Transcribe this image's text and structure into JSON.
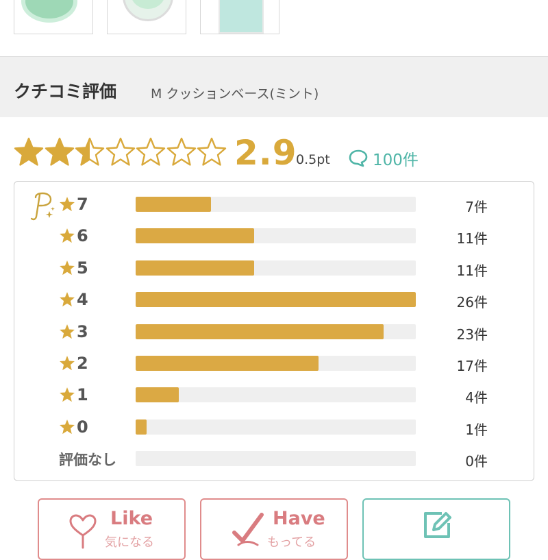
{
  "section": {
    "title": "クチコミ評価",
    "product_name": "M クッションベース(ミント)"
  },
  "summary": {
    "score": "2.9",
    "score_value": 2.9,
    "max_stars": 7,
    "points": "0.5pt",
    "review_count": "100件",
    "star_color": "#d9a93b",
    "link_color": "#4fb5a7"
  },
  "distribution": {
    "bar_color": "#dba944",
    "track_color": "#efefef",
    "rows": [
      {
        "label": "7",
        "count": "7件",
        "value": 7
      },
      {
        "label": "6",
        "count": "11件",
        "value": 11
      },
      {
        "label": "5",
        "count": "11件",
        "value": 11
      },
      {
        "label": "4",
        "count": "26件",
        "value": 26
      },
      {
        "label": "3",
        "count": "23件",
        "value": 23
      },
      {
        "label": "2",
        "count": "17件",
        "value": 17
      },
      {
        "label": "1",
        "count": "4件",
        "value": 4
      },
      {
        "label": "0",
        "count": "1件",
        "value": 1
      },
      {
        "label": "評価なし",
        "count": "0件",
        "value": 0
      }
    ],
    "max_value": 26
  },
  "buttons": {
    "like": {
      "label": "Like",
      "sub": "気になる"
    },
    "have": {
      "label": "Have",
      "sub": "もってる"
    },
    "review": {
      "label": "",
      "sub": ""
    }
  },
  "icons": {
    "logo": "premium-p-icon",
    "count": "speech-bubble-icon",
    "like": "heart-stem-icon",
    "have": "check-icon",
    "review": "edit-icon"
  }
}
